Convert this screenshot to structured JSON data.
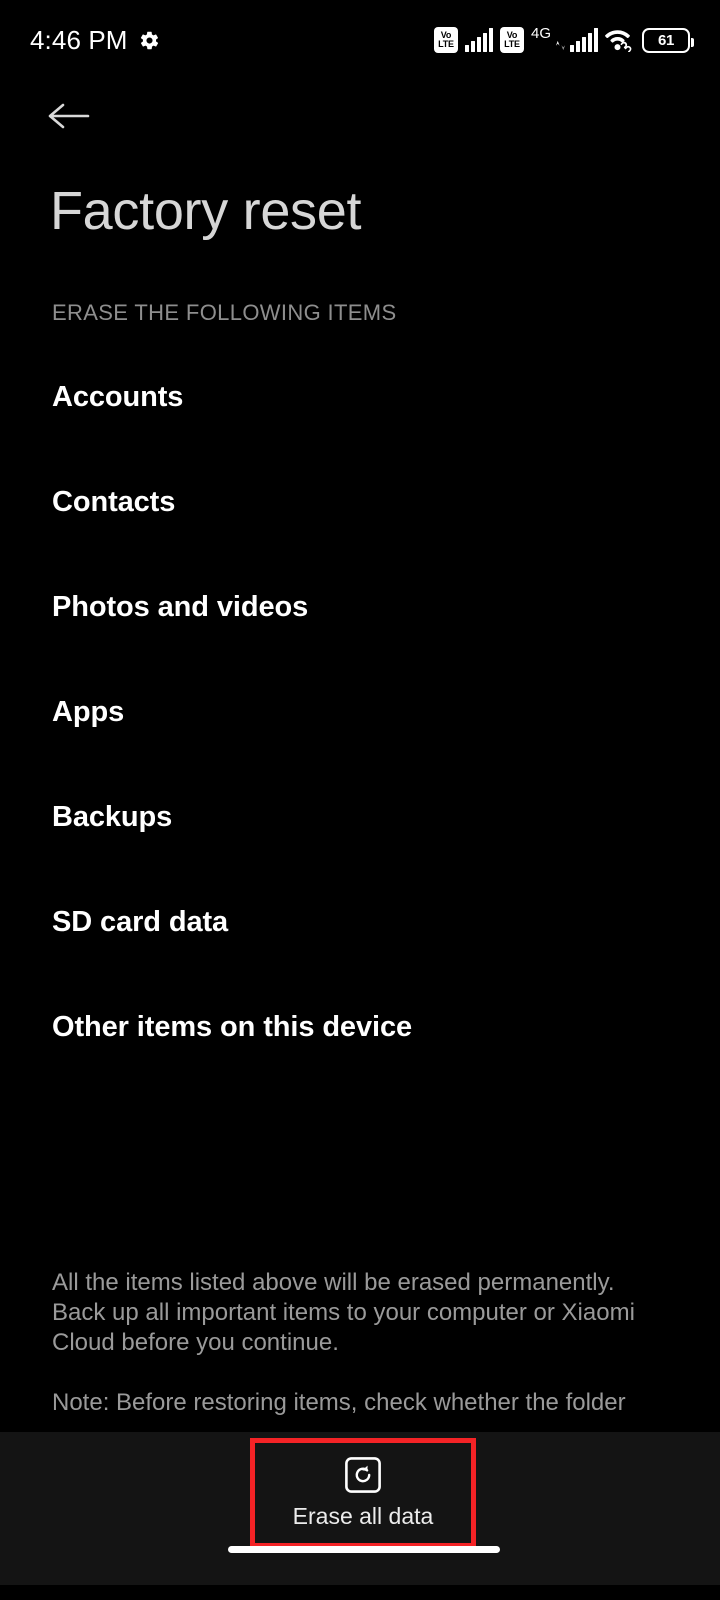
{
  "status_bar": {
    "time": "4:46 PM",
    "gear_icon": "gear-icon",
    "sim1_volte_top": "Vo",
    "sim1_volte_bottom": "LTE",
    "sim2_volte_top": "Vo",
    "sim2_volte_bottom": "LTE",
    "network_type": "4G",
    "wifi_icon": "wifi-icon",
    "battery_percent": "61"
  },
  "header": {
    "back_icon": "arrow-left-icon",
    "title": "Factory reset"
  },
  "section": {
    "heading": "ERASE THE FOLLOWING ITEMS",
    "items": [
      {
        "label": "Accounts"
      },
      {
        "label": "Contacts"
      },
      {
        "label": "Photos and videos"
      },
      {
        "label": "Apps"
      },
      {
        "label": "Backups"
      },
      {
        "label": "SD card data"
      },
      {
        "label": "Other items on this device"
      }
    ]
  },
  "footer": {
    "paragraph": "All the items listed above will be erased permanently. Back up all important items to your computer or Xiaomi Cloud before you continue.",
    "note_clipped": "Note: Before restoring items, check whether the folder"
  },
  "action_bar": {
    "erase_icon": "reset-restore-icon",
    "erase_label": "Erase all data",
    "highlight_color": "#f42326"
  },
  "navigation": {
    "home_indicator": "home-indicator"
  },
  "colors": {
    "background": "#000000",
    "bar_background": "#141414",
    "title_text": "#d6d6d6",
    "item_text": "#ffffff",
    "muted_text": "#8e8e8e",
    "footer_text": "#9a9a9a",
    "highlight": "#f42326"
  }
}
